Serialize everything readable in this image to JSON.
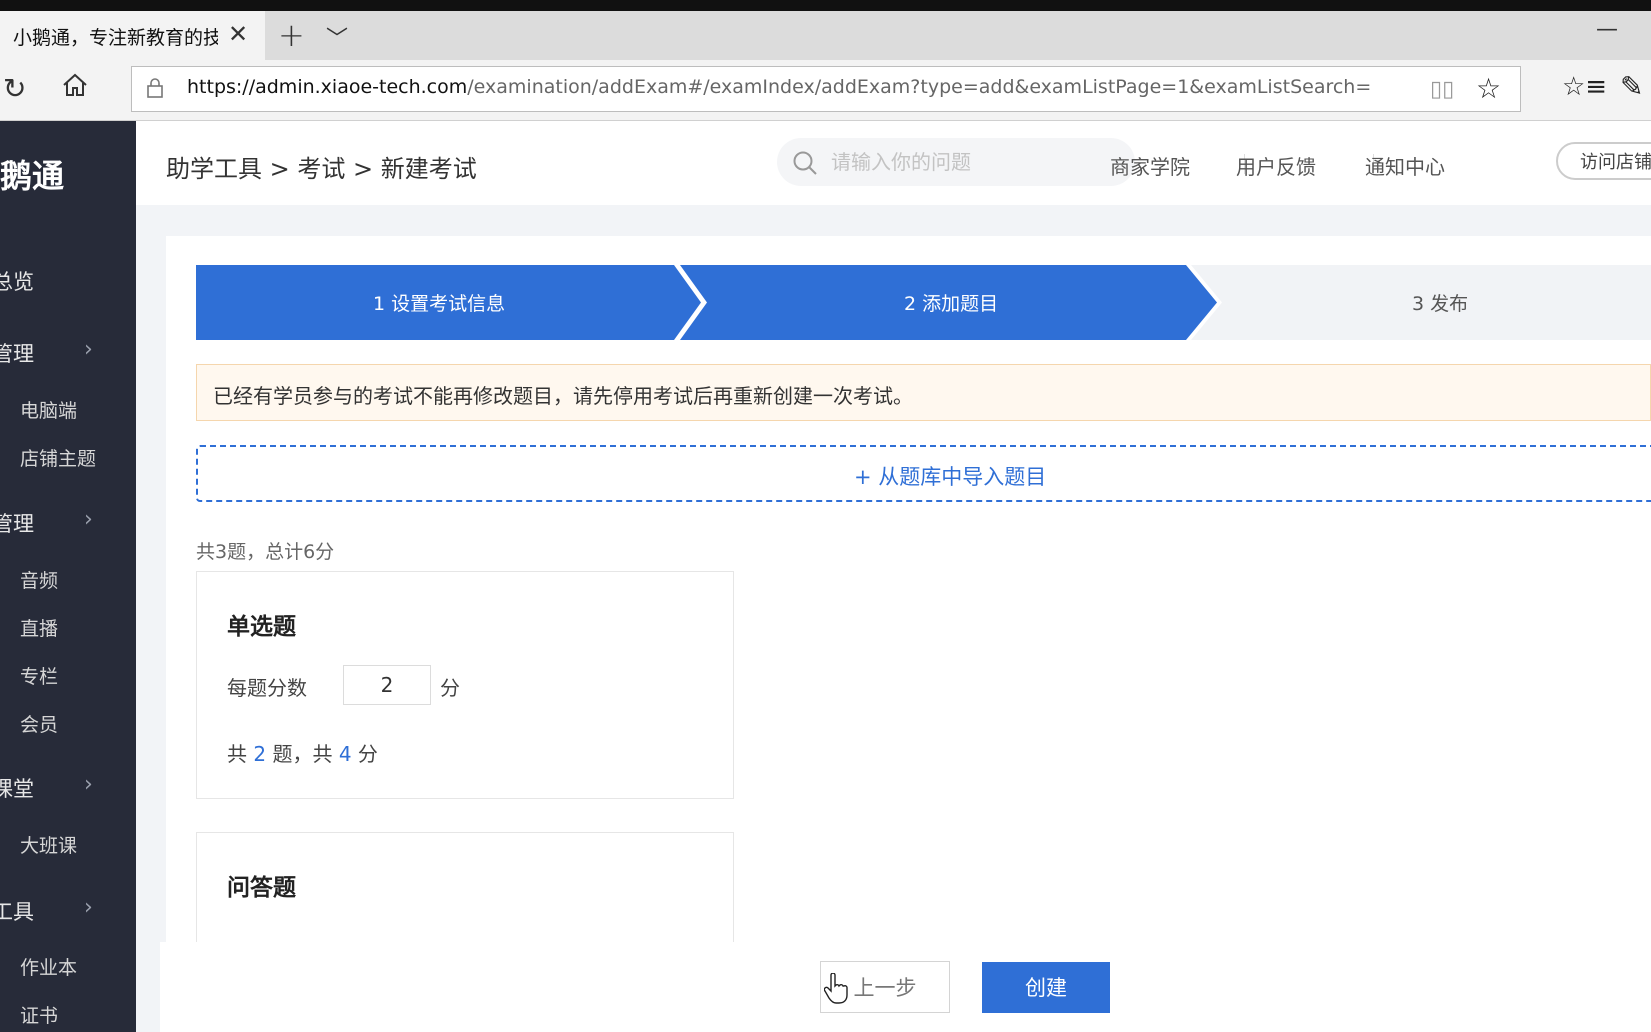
{
  "browser": {
    "tab_title": "小鹅通，专注新教育的技",
    "url_host": "https://admin.xiaoe-tech.com",
    "url_path": "/examination/addExam#/examIndex/addExam?type=add&examListPage=1&examListSearch="
  },
  "sidebar": {
    "brand": "鹅通",
    "items": [
      {
        "label": "总览",
        "type": "main"
      },
      {
        "label": "管理",
        "type": "main"
      },
      {
        "label": "电脑端",
        "type": "sub"
      },
      {
        "label": "店铺主题",
        "type": "sub"
      },
      {
        "label": "管理",
        "type": "main"
      },
      {
        "label": "音频",
        "type": "sub"
      },
      {
        "label": "直播",
        "type": "sub"
      },
      {
        "label": "专栏",
        "type": "sub"
      },
      {
        "label": "会员",
        "type": "sub"
      },
      {
        "label": "课堂",
        "type": "main"
      },
      {
        "label": "大班课",
        "type": "sub"
      },
      {
        "label": "工具",
        "type": "main"
      },
      {
        "label": "作业本",
        "type": "sub"
      },
      {
        "label": "证书",
        "type": "sub"
      }
    ]
  },
  "header": {
    "breadcrumb": "助学工具 > 考试 > 新建考试",
    "search_placeholder": "请输入你的问题",
    "links": [
      "商家学院",
      "用户反馈",
      "通知中心"
    ],
    "visit_button": "访问店铺"
  },
  "steps": [
    {
      "label": "1 设置考试信息",
      "active": true
    },
    {
      "label": "2 添加题目",
      "active": true
    },
    {
      "label": "3 发布",
      "active": false
    }
  ],
  "notice": "已经有学员参与的考试不能再修改题目，请先停用考试后再重新创建一次考试。",
  "import_button": "+ 从题库中导入题目",
  "summary": "共3题，总计6分",
  "question_groups": [
    {
      "title": "单选题",
      "score_label": "每题分数",
      "score_value": "2",
      "unit": "分",
      "count_prefix": "共",
      "count": "2",
      "count_mid": "题，共",
      "total": "4",
      "count_suffix": "分"
    },
    {
      "title": "问答题"
    }
  ],
  "footer": {
    "prev_label": "上一步",
    "create_label": "创建"
  },
  "colors": {
    "accent": "#2f6fd6",
    "sidebar_bg": "#272b39",
    "notice_bg": "#fff8ef"
  }
}
